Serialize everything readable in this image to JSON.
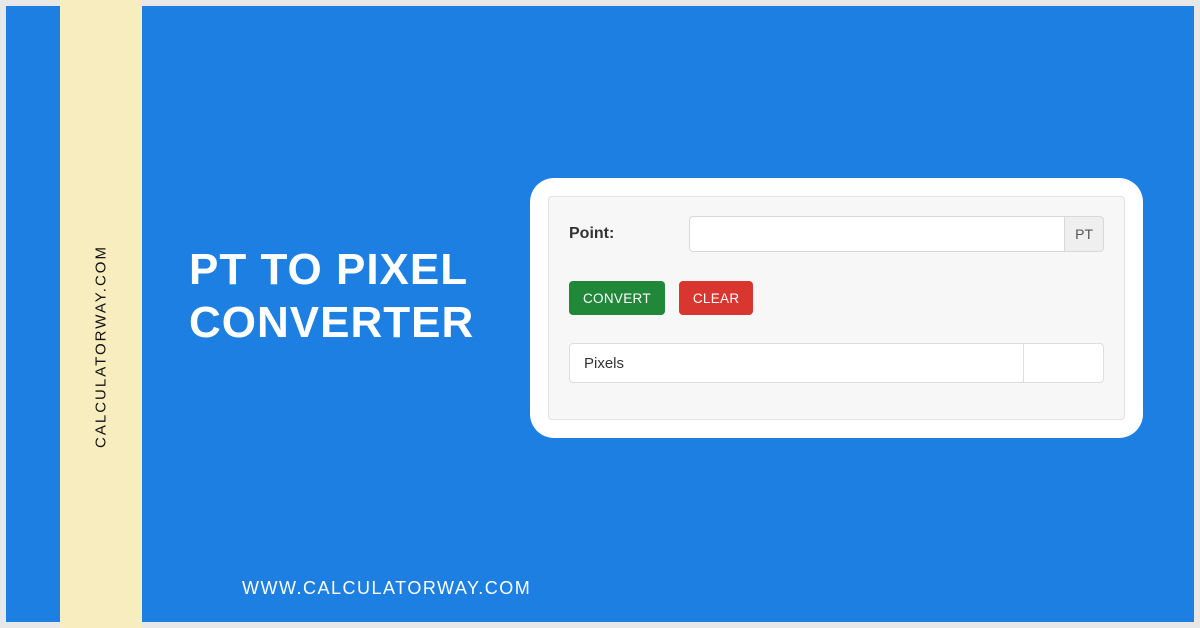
{
  "brand": {
    "sidebar_text": "CALCULATORWAY.COM",
    "footer_url": "WWW.CALCULATORWAY.COM"
  },
  "hero": {
    "line1": "PT TO PIXEL",
    "line2": "CONVERTER"
  },
  "converter": {
    "point_label": "Point:",
    "point_value": "",
    "point_unit": "PT",
    "convert_label": "CONVERT",
    "clear_label": "CLEAR",
    "result_label": "Pixels",
    "result_value": ""
  },
  "colors": {
    "primary_bg": "#1D7FE2",
    "stripe": "#F8EDBE",
    "convert_btn": "#218739",
    "clear_btn": "#D9362F"
  }
}
